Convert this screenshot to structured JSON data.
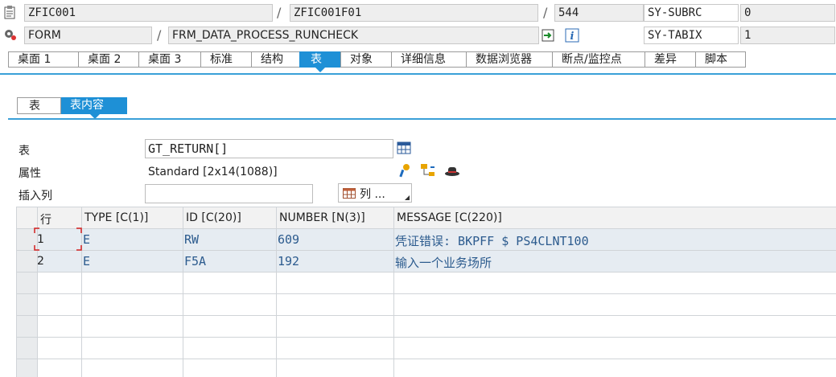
{
  "header": {
    "program": "ZFIC001",
    "include": "ZFIC001F01",
    "line": "544",
    "sy_subrc_label": "SY-SUBRC",
    "sy_subrc_value": "0",
    "event_type": "FORM",
    "event_name": "FRM_DATA_PROCESS_RUNCHECK",
    "sy_tabix_label": "SY-TABIX",
    "sy_tabix_value": "1"
  },
  "tabs": [
    "桌面 1",
    "桌面 2",
    "桌面 3",
    "标准",
    "结构",
    "表",
    "对象",
    "详细信息",
    "数据浏览器",
    "断点/监控点",
    "差异",
    "脚本"
  ],
  "active_tab": "表",
  "subtabs": [
    "表",
    "表内容"
  ],
  "active_subtab": "表内容",
  "form": {
    "table_label": "表",
    "table_value": "GT_RETURN[]",
    "attr_label": "属性",
    "attr_value": "Standard [2x14(1088)]",
    "insert_label": "插入列",
    "insert_value": "",
    "columns_button": "列 ..."
  },
  "grid": {
    "headers": [
      "行",
      "TYPE [C(1)]",
      "ID [C(20)]",
      "NUMBER [N(3)]",
      "MESSAGE [C(220)]"
    ],
    "rows": [
      {
        "n": "1",
        "type": "E",
        "id": "RW",
        "number": "609",
        "message": "凭证错误: BKPFF $ PS4CLNT100"
      },
      {
        "n": "2",
        "type": "E",
        "id": "F5A",
        "number": "192",
        "message": "输入一个业务场所"
      }
    ]
  },
  "colors": {
    "accent": "#1e90d6",
    "row_bg": "#e6ecf2",
    "value_text": "#2c5b8e"
  }
}
